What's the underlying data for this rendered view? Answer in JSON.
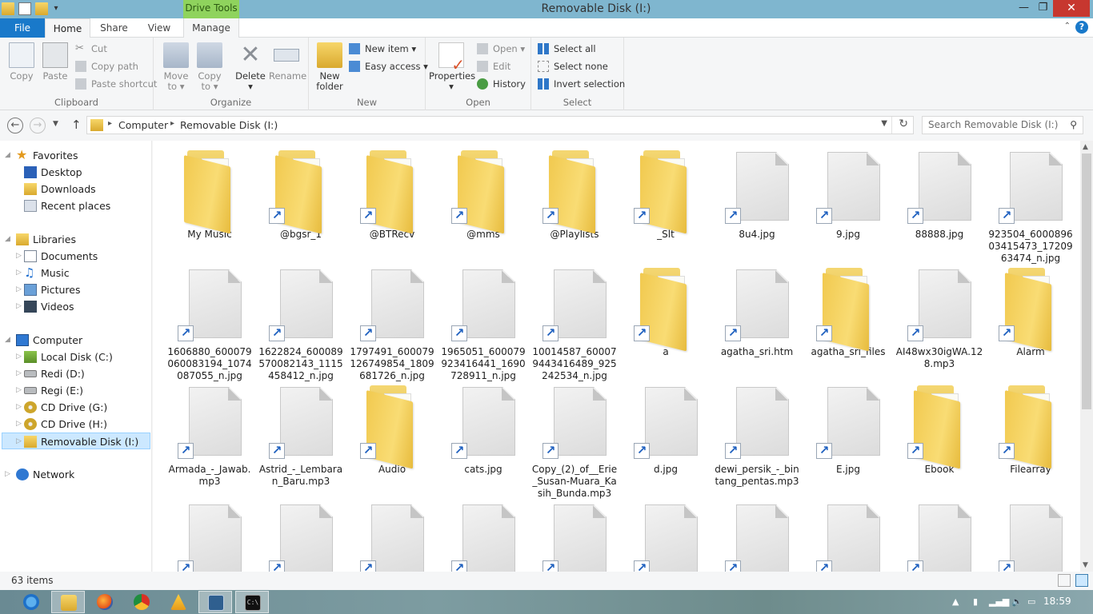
{
  "window": {
    "title": "Removable Disk (I:)",
    "contextual_tab_group": "Drive Tools",
    "minimize": "—",
    "maximize": "❐",
    "close": "✕"
  },
  "tabs": [
    "File",
    "Home",
    "Share",
    "View",
    "Manage"
  ],
  "ribbon": {
    "clipboard": {
      "label": "Clipboard",
      "copy": "Copy",
      "paste": "Paste",
      "cut": "Cut",
      "copy_path": "Copy path",
      "paste_shortcut": "Paste shortcut"
    },
    "organize": {
      "label": "Organize",
      "move_to_1": "Move",
      "move_to_2": "to ▾",
      "copy_to_1": "Copy",
      "copy_to_2": "to ▾",
      "delete": "Delete",
      "delete_arrow": "▾",
      "rename": "Rename"
    },
    "new": {
      "label": "New",
      "new_folder_1": "New",
      "new_folder_2": "folder",
      "new_item": "New item ▾",
      "easy_access": "Easy access ▾"
    },
    "open": {
      "label": "Open",
      "properties": "Properties",
      "properties_arrow": "▾",
      "open": "Open ▾",
      "edit": "Edit",
      "history": "History"
    },
    "select": {
      "label": "Select",
      "select_all": "Select all",
      "select_none": "Select none",
      "invert_selection": "Invert selection"
    }
  },
  "address": {
    "crumbs": [
      "Computer",
      "Removable Disk (I:)"
    ],
    "search_placeholder": "Search Removable Disk (I:)"
  },
  "nav": {
    "favorites": "Favorites",
    "desktop": "Desktop",
    "downloads": "Downloads",
    "recent": "Recent places",
    "libraries": "Libraries",
    "documents": "Documents",
    "music": "Music",
    "pictures": "Pictures",
    "videos": "Videos",
    "computer": "Computer",
    "local_c": "Local Disk (C:)",
    "redi_d": "Redi (D:)",
    "regi_e": "Regi (E:)",
    "cd_g": "CD Drive (G:)",
    "cd_h": "CD Drive (H:)",
    "removable_i": "Removable Disk (I:)",
    "network": "Network"
  },
  "items": [
    {
      "name": "My Music",
      "type": "folder",
      "shortcut": false
    },
    {
      "name": "@bgsr_1",
      "type": "folder",
      "shortcut": true
    },
    {
      "name": "@BTRecv",
      "type": "folder",
      "shortcut": true
    },
    {
      "name": "@mms",
      "type": "folder",
      "shortcut": true
    },
    {
      "name": "@Playlists",
      "type": "folder",
      "shortcut": true
    },
    {
      "name": "_Slt",
      "type": "folder",
      "shortcut": true
    },
    {
      "name": "8u4.jpg",
      "type": "file",
      "shortcut": true
    },
    {
      "name": "9.jpg",
      "type": "file",
      "shortcut": true
    },
    {
      "name": "88888.jpg",
      "type": "file",
      "shortcut": true
    },
    {
      "name": "923504_600089603415473_1720963474_n.jpg",
      "type": "file",
      "shortcut": true
    },
    {
      "name": "1606880_600079060083194_1074087055_n.jpg",
      "type": "file",
      "shortcut": true
    },
    {
      "name": "1622824_600089570082143_1115458412_n.jpg",
      "type": "file",
      "shortcut": true
    },
    {
      "name": "1797491_600079126749854_1809681726_n.jpg",
      "type": "file",
      "shortcut": true
    },
    {
      "name": "1965051_600079923416441_1690728911_n.jpg",
      "type": "file",
      "shortcut": true
    },
    {
      "name": "10014587_600079443416489_925242534_n.jpg",
      "type": "file",
      "shortcut": true
    },
    {
      "name": "a",
      "type": "folder",
      "shortcut": true
    },
    {
      "name": "agatha_sri.htm",
      "type": "file",
      "shortcut": true
    },
    {
      "name": "agatha_sri_files",
      "type": "folder",
      "shortcut": true
    },
    {
      "name": "AI48wx30igWA.128.mp3",
      "type": "file",
      "shortcut": true
    },
    {
      "name": "Alarm",
      "type": "folder",
      "shortcut": true
    },
    {
      "name": "Armada_-_Jawab.mp3",
      "type": "file",
      "shortcut": true
    },
    {
      "name": "Astrid_-_Lembaran_Baru.mp3",
      "type": "file",
      "shortcut": true
    },
    {
      "name": "Audio",
      "type": "folder",
      "shortcut": true
    },
    {
      "name": "cats.jpg",
      "type": "file",
      "shortcut": true
    },
    {
      "name": "Copy_(2)_of__Erie_Susan-Muara_Kasih_Bunda.mp3",
      "type": "file",
      "shortcut": true
    },
    {
      "name": "d.jpg",
      "type": "file",
      "shortcut": true
    },
    {
      "name": "dewi_persik_-_bintang_pentas.mp3",
      "type": "file",
      "shortcut": true
    },
    {
      "name": "E.jpg",
      "type": "file",
      "shortcut": true
    },
    {
      "name": "Ebook",
      "type": "folder",
      "shortcut": true
    },
    {
      "name": "Filearray",
      "type": "folder",
      "shortcut": true
    },
    {
      "name": "",
      "type": "file",
      "shortcut": true
    },
    {
      "name": "",
      "type": "file",
      "shortcut": true
    },
    {
      "name": "",
      "type": "file",
      "shortcut": true
    },
    {
      "name": "",
      "type": "file",
      "shortcut": true
    },
    {
      "name": "",
      "type": "file",
      "shortcut": true
    },
    {
      "name": "",
      "type": "file",
      "shortcut": true
    },
    {
      "name": "",
      "type": "file",
      "shortcut": true
    },
    {
      "name": "",
      "type": "file",
      "shortcut": true
    },
    {
      "name": "",
      "type": "file",
      "shortcut": true
    },
    {
      "name": "",
      "type": "file",
      "shortcut": true
    }
  ],
  "status": {
    "count": "63 items"
  },
  "taskbar": {
    "clock": "18:59"
  },
  "colors": {
    "accent": "#1979ca",
    "titlebar": "#7fb6cf",
    "drive_tools": "#8fd35d",
    "selection": "#cce8ff"
  }
}
